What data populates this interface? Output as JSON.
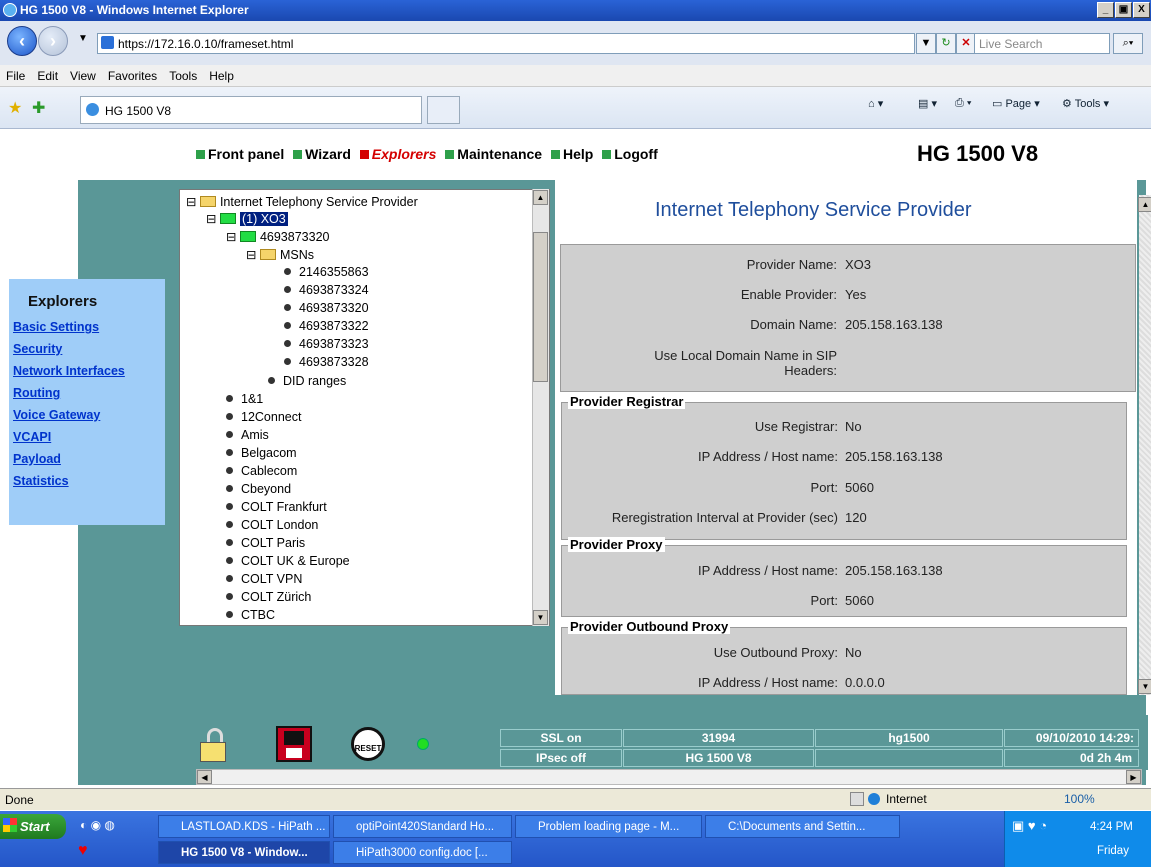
{
  "window": {
    "title": "HG 1500 V8 - Windows Internet Explorer",
    "min": "_",
    "max": "▣",
    "close": "X"
  },
  "browser": {
    "address": "https://172.16.0.10/frameset.html",
    "search_placeholder": "Live Search",
    "tab": "HG 1500 V8",
    "page_menu": "Page",
    "tools_menu": "Tools"
  },
  "menu": [
    "File",
    "Edit",
    "View",
    "Favorites",
    "Tools",
    "Help"
  ],
  "topnav": [
    {
      "label": "Front panel"
    },
    {
      "label": "Wizard"
    },
    {
      "label": "Explorers"
    },
    {
      "label": "Maintenance"
    },
    {
      "label": "Help"
    },
    {
      "label": "Logoff"
    }
  ],
  "brand": "HG 1500 V8",
  "sidebar": {
    "title": "Explorers",
    "items": [
      "Basic Settings",
      "Security",
      "Network Interfaces",
      "Routing",
      "Voice Gateway",
      "VCAPI",
      "Payload",
      "Statistics"
    ]
  },
  "tree": {
    "root": "Internet Telephony Service Provider",
    "selected": "(1) XO3",
    "number": "4693873320",
    "msns_label": "MSNs",
    "msns": [
      "2146355863",
      "4693873324",
      "4693873320",
      "4693873322",
      "4693873323",
      "4693873328"
    ],
    "did": "DID ranges",
    "providers": [
      "1&1",
      "12Connect",
      "Amis",
      "Belgacom",
      "Cablecom",
      "Cbeyond",
      "COLT Frankfurt",
      "COLT London",
      "COLT Paris",
      "COLT UK & Europe",
      "COLT VPN",
      "COLT Zürich",
      "CTBC"
    ]
  },
  "content": {
    "title": "Internet Telephony Service Provider",
    "general": [
      {
        "label": "Provider Name:",
        "value": "XO3"
      },
      {
        "label": "Enable Provider:",
        "value": "Yes"
      },
      {
        "label": "Domain Name:",
        "value": "205.158.163.138"
      },
      {
        "label": "Use Local Domain Name in SIP Headers:",
        "value": ""
      }
    ],
    "registrar": {
      "legend": "Provider Registrar",
      "rows": [
        {
          "label": "Use Registrar:",
          "value": "No"
        },
        {
          "label": "IP Address / Host name:",
          "value": "205.158.163.138"
        },
        {
          "label": "Port:",
          "value": "5060"
        },
        {
          "label": "Reregistration Interval at Provider (sec)",
          "value": "120"
        }
      ]
    },
    "proxy": {
      "legend": "Provider Proxy",
      "rows": [
        {
          "label": "IP Address / Host name:",
          "value": "205.158.163.138"
        },
        {
          "label": "Port:",
          "value": "5060"
        }
      ]
    },
    "outbound": {
      "legend": "Provider Outbound Proxy",
      "rows": [
        {
          "label": "Use Outbound Proxy:",
          "value": "No"
        },
        {
          "label": "IP Address / Host name:",
          "value": "0.0.0.0"
        }
      ]
    }
  },
  "statusbar_bottom": {
    "ssl": "SSL on",
    "ipsec": "IPsec off",
    "num": "31994",
    "model": "HG 1500 V8",
    "host": "hg1500",
    "host2": "",
    "datetime": "09/10/2010 14:29:",
    "uptime": "0d 2h 4m",
    "reset": "RESET"
  },
  "ie_status": {
    "left": "Done",
    "zone": "Internet",
    "zoom": "100%"
  },
  "taskbar": {
    "start": "Start",
    "tasks": [
      "LASTLOAD.KDS - HiPath ...",
      "optiPoint420Standard Ho...",
      "Problem loading page - M...",
      "C:\\Documents and Settin...",
      "HG 1500 V8 - Window...",
      "HiPath3000 config.doc [..."
    ],
    "time": "4:24 PM",
    "day": "Friday"
  }
}
